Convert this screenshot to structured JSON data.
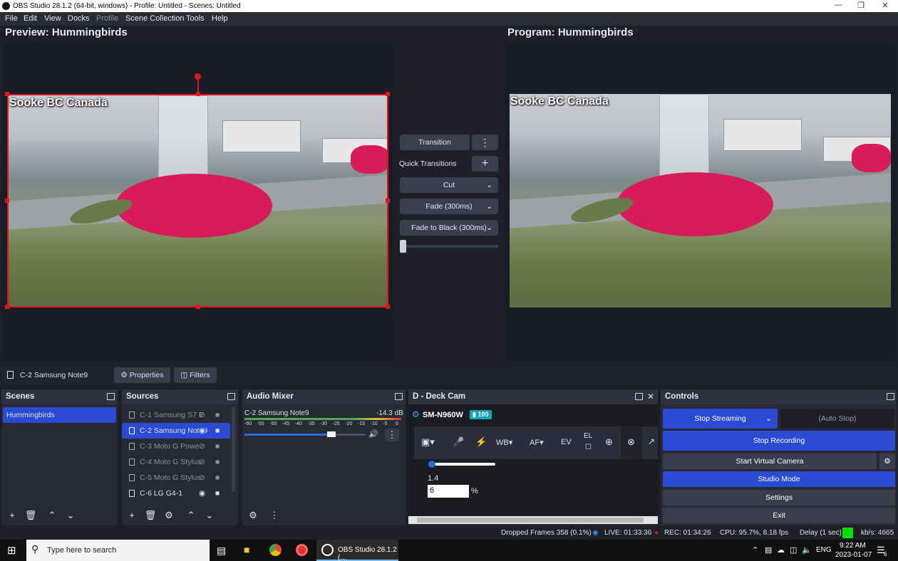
{
  "window": {
    "title": "OBS Studio 28.1.2 (64-bit, windows) - Profile: Untitled - Scenes: Untitled"
  },
  "menu": [
    "File",
    "Edit",
    "View",
    "Docks",
    "Profile",
    "Scene Collection",
    "Tools",
    "Help"
  ],
  "preview": {
    "title": "Preview: Hummingbirds",
    "overlay": "Sooke BC Canada"
  },
  "program": {
    "title": "Program: Hummingbirds",
    "overlay": "Sooke BC Canada"
  },
  "transitions": {
    "transition_label": "Transition",
    "quick_label": "Quick Transitions",
    "items": [
      "Cut",
      "Fade (300ms)",
      "Fade to Black (300ms)"
    ]
  },
  "source_toolbar": {
    "name": "C-2 Samsung Note9",
    "properties": "Properties",
    "filters": "Filters"
  },
  "scenes": {
    "title": "Scenes",
    "items": [
      "Hummingbirds"
    ]
  },
  "sources": {
    "title": "Sources",
    "items": [
      {
        "label": "C-1 Samsung S7 E",
        "visible": false
      },
      {
        "label": "C-2 Samsung Note9",
        "visible": true
      },
      {
        "label": "C-3 Moto G Powe",
        "visible": false
      },
      {
        "label": "C-4 Moto G Stylus",
        "visible": false
      },
      {
        "label": "C-5 Moto G Stylus",
        "visible": false
      },
      {
        "label": "C-6 LG G4-1",
        "visible": true
      }
    ]
  },
  "mixer": {
    "title": "Audio Mixer",
    "channel": "C-2 Samsung Note9",
    "db": "-14.3 dB",
    "scale": [
      "-60",
      "-55",
      "-50",
      "-45",
      "-40",
      "-35",
      "-30",
      "-25",
      "-20",
      "-15",
      "-10",
      "-5",
      "0"
    ],
    "volume_level": 0.72
  },
  "deckcam": {
    "title": "D - Deck Cam",
    "device": "SM-N960W",
    "battery": "100",
    "tools": [
      "WB",
      "AF",
      "EV",
      "EL"
    ],
    "zoom_value": "1.4",
    "percent_value": "6",
    "percent_unit": "%"
  },
  "controls": {
    "title": "Controls",
    "stop_streaming": "Stop Streaming",
    "auto_stop": "(Auto Stop)",
    "stop_recording": "Stop Recording",
    "virtual_camera": "Start Virtual Camera",
    "studio_mode": "Studio Mode",
    "settings": "Settings",
    "exit": "Exit"
  },
  "status": {
    "dropped": "Dropped Frames 358 (0.1%)",
    "live": "LIVE: 01:33:36",
    "rec": "REC: 01:34:26",
    "cpu": "CPU: 95.7%, 8.18 fps",
    "delay": "Delay (1 sec)",
    "kbps": "kb/s: 4665"
  },
  "taskbar": {
    "search_placeholder": "Type here to search",
    "obs_task": "OBS Studio 28.1.2 (...",
    "lang": "ENG",
    "time": "9:22 AM",
    "date": "2023-01-07",
    "notif_count": "6"
  },
  "colors": {
    "accent": "#2a4bd1",
    "selection": "#e0161e",
    "live": "#00e000"
  }
}
